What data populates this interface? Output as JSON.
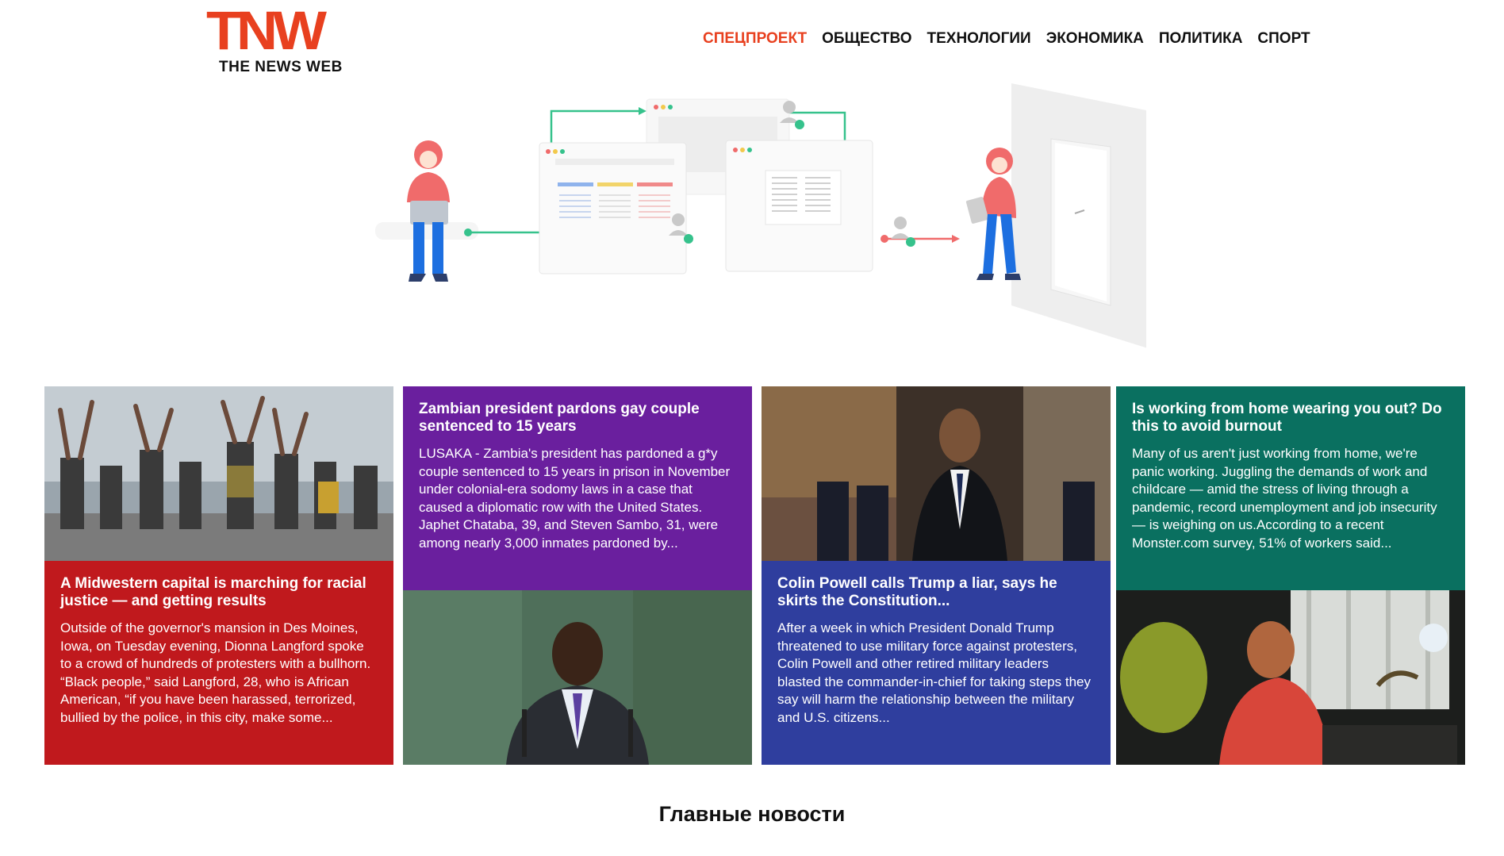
{
  "logo": {
    "mark": "TNW",
    "subtitle": "THE NEWS WEB"
  },
  "nav": [
    {
      "label": "СПЕЦПРОЕКТ",
      "active": true
    },
    {
      "label": "ОБЩЕСТВО",
      "active": false
    },
    {
      "label": "ТЕХНОЛОГИИ",
      "active": false
    },
    {
      "label": "ЭКОНОМИКА",
      "active": false
    },
    {
      "label": "ПОЛИТИКА",
      "active": false
    },
    {
      "label": "СПОРТ",
      "active": false
    }
  ],
  "cards": [
    {
      "color": "#c0191d",
      "title": "A Midwestern capital is marching for racial justice — and getting results",
      "text": "Outside of the governor's mansion in Des Moines, Iowa, on Tuesday evening, Dionna Langford spoke to a crowd of hundreds of protesters with a bullhorn. “Black people,” said Langford, 28, who is African American, “if you have been harassed, terrorized, bullied by the police, in this city, make some..."
    },
    {
      "color": "#6a1f9e",
      "title": "Zambian president pardons gay couple sentenced to 15 years",
      "text": "LUSAKA - Zambia's president has pardoned a g*y couple sentenced to 15 years in prison in November under colonial-era sodomy laws in a case that caused a diplomatic row with the United States. Japhet Chataba, 39, and Steven Sambo, 31, were among nearly 3,000 inmates pardoned by..."
    },
    {
      "color": "#2f3e9e",
      "title": "Colin Powell calls Trump a liar, says he skirts the Constitution...",
      "text": "After a week in which President Donald Trump threatened to use military force against protesters, Colin Powell and other retired military leaders blasted the commander-in-chief for taking steps they say will harm the relationship between the military and U.S. citizens..."
    },
    {
      "color": "#0a7060",
      "title": "Is working from home wearing you out? Do this to avoid burnout",
      "text": "Many of us aren't just working from home, we're panic working. Juggling the demands of work and childcare — amid the stress of living through a pandemic, record unemployment and job insecurity — is weighing on us.According to a recent Monster.com survey, 51% of workers said..."
    }
  ],
  "section_title": "Главные новости"
}
